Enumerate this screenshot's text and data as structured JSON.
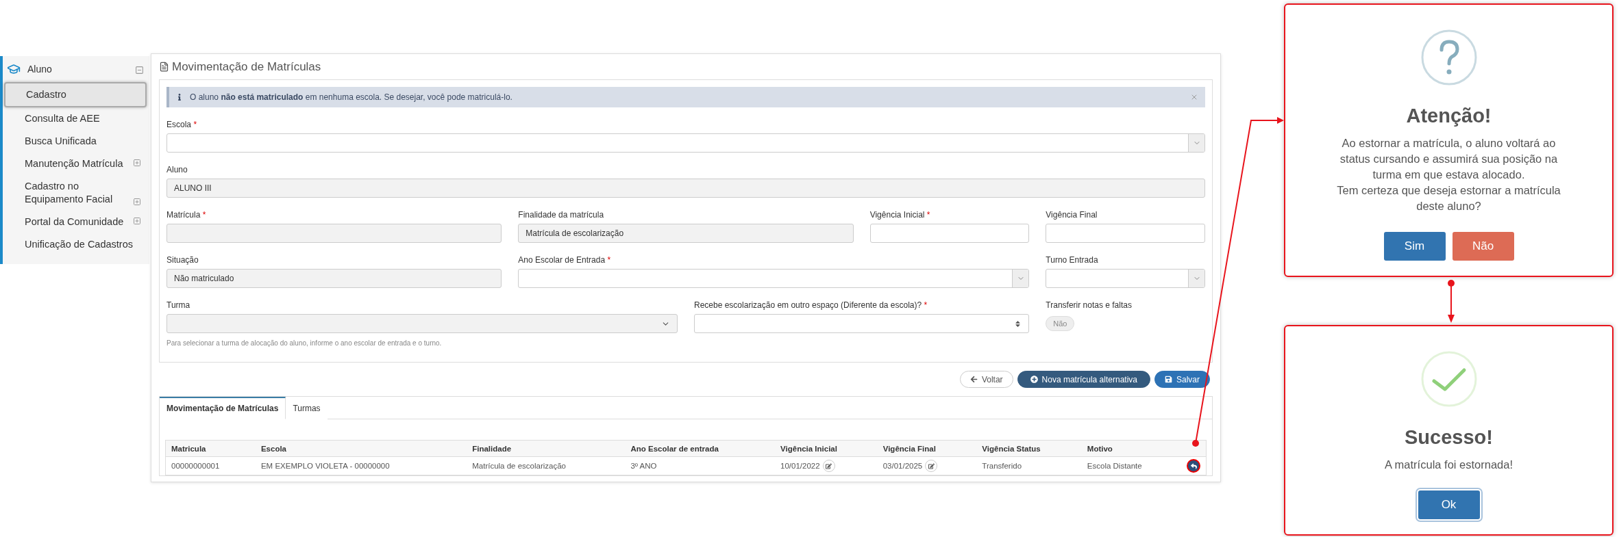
{
  "sidebar": {
    "section": {
      "label": "Aluno",
      "expanded": true
    },
    "items": [
      {
        "label": "Cadastro",
        "kind": "link",
        "selected": true
      },
      {
        "label": "Consulta de AEE",
        "kind": "link",
        "selected": false
      },
      {
        "label": "Busca Unificada",
        "kind": "link",
        "selected": false
      },
      {
        "label": "Manutenção Matrícula",
        "kind": "group",
        "expanded": false,
        "selected": false
      },
      {
        "label": "Cadastro no Equipamento Facial",
        "kind": "group",
        "expanded": false,
        "selected": false
      },
      {
        "label": "Portal da Comunidade",
        "kind": "group",
        "expanded": false,
        "selected": false
      },
      {
        "label": "Unificação de Cadastros",
        "kind": "link",
        "selected": false
      }
    ]
  },
  "page": {
    "title": "Movimentação de Matrículas",
    "alert": {
      "text": "O aluno **não está matriculado** em nenhuma escola. Se desejar, você pode matriculá-lo."
    },
    "form_rows": [
      [
        {
          "kind": "select",
          "label": "Escola",
          "required_mark": "*",
          "disabled": false
        }
      ],
      [
        {
          "kind": "text",
          "label": "Aluno",
          "disabled": true,
          "value": "ALUNO III"
        }
      ],
      [
        {
          "kind": "text",
          "label": "Matrícula",
          "required_mark": "*",
          "disabled": true
        },
        {
          "kind": "text",
          "label": "Finalidade da matrícula",
          "disabled": true,
          "value": "Matrícula de escolarização"
        },
        {
          "kind": "text",
          "label": "Vigência Inicial",
          "required_mark": "*",
          "disabled": false
        },
        {
          "kind": "text",
          "label": "Vigência Final",
          "disabled": false
        }
      ],
      [
        {
          "kind": "text",
          "label": "Situação",
          "disabled": true,
          "value": "Não matriculado"
        },
        {
          "kind": "select",
          "label": "Ano Escolar de Entrada",
          "required_mark": "*",
          "disabled": false
        },
        {
          "kind": "select",
          "label": "Turno Entrada",
          "disabled": false
        }
      ],
      [
        {
          "kind": "select",
          "label": "Turma",
          "disabled": true,
          "hint": "Para selecionar a turma de alocação do aluno, informe o ano escolar de entrada e o turno."
        },
        {
          "kind": "native-select",
          "label": "Recebe escolarização em outro espaço (Diferente da escola)?",
          "required_mark": "*",
          "disabled": false
        },
        {
          "kind": "toggle",
          "label": "Transferir notas e faltas",
          "on": false,
          "state_label": "Não"
        }
      ]
    ],
    "buttons": [
      {
        "label": "Voltar",
        "kind": "back"
      },
      {
        "label": "Nova matrícula alternativa",
        "kind": "add"
      },
      {
        "label": "Salvar",
        "kind": "save"
      }
    ],
    "tabs": [
      {
        "label": "Movimentação de Matrículas",
        "selected": true
      },
      {
        "label": "Turmas",
        "selected": false
      }
    ],
    "table": {
      "columns": [
        "Matricula",
        "Escola",
        "Finalidade",
        "Ano Escolar de entrada",
        "Vigência Inicial",
        "Vigência Final",
        "Vigência Status",
        "Motivo"
      ],
      "rows": [
        {
          "cells": [
            {
              "text": "00000000001",
              "editable": false
            },
            {
              "text": "EM EXEMPLO VIOLETA - 00000000",
              "editable": false
            },
            {
              "text": "Matrícula de escolarização",
              "editable": false
            },
            {
              "text": "3º ANO",
              "editable": false
            },
            {
              "text": "10/01/2022",
              "editable": true
            },
            {
              "text": "03/01/2025",
              "editable": true
            },
            {
              "text": "Transferido",
              "editable": false
            },
            {
              "text": "Escola Distante",
              "editable": false
            }
          ]
        }
      ]
    }
  },
  "dialogs": [
    {
      "kind": "question",
      "title": "Atenção!",
      "message": [
        "Ao estornar a matrícula, o aluno voltará ao status cursando e assumirá sua posição na turma em que estava alocado.",
        "Tem certeza que deseja estornar a matrícula deste aluno?"
      ],
      "buttons": [
        {
          "label": "Sim",
          "kind": "confirm",
          "focused": false
        },
        {
          "label": "Não",
          "kind": "cancel",
          "focused": false
        }
      ]
    },
    {
      "kind": "success",
      "title": "Sucesso!",
      "message": [
        "A matrícula foi estornada!"
      ],
      "buttons": [
        {
          "label": "Ok",
          "kind": "confirm",
          "focused": true
        }
      ]
    }
  ]
}
